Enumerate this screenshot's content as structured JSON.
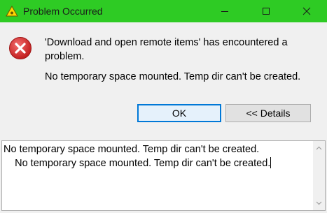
{
  "window": {
    "title": "Problem Occurred",
    "title_bar_color": "#2ecb24",
    "controls": [
      "minimize-icon",
      "maximize-icon",
      "close-icon"
    ]
  },
  "dialog": {
    "icon": "error-icon",
    "message_line1": "'Download and open remote items' has encountered a problem.",
    "message_line2": "No temporary space mounted. Temp dir can't be created."
  },
  "buttons": {
    "ok_label": "OK",
    "details_label": "<< Details"
  },
  "details": {
    "line1": "No temporary space mounted. Temp dir can't be created.",
    "line2": "    No temporary space mounted. Temp dir can't be created."
  },
  "colors": {
    "accent": "#0078d7",
    "error_red": "#d13438"
  }
}
